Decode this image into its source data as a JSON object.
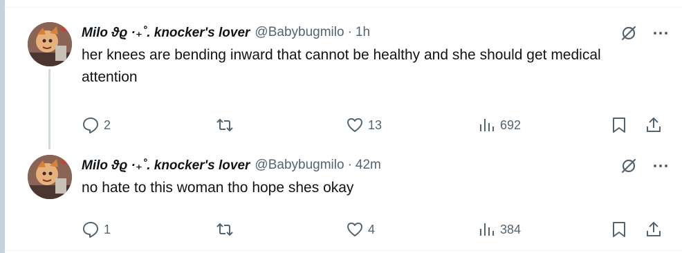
{
  "tweets": [
    {
      "display_name": "Milo ϑϱ ·₊˚. knocker's lover",
      "handle": "@Babybugmilo",
      "separator": "·",
      "time": "1h",
      "text": "her knees are bending inward that cannot be healthy and she should get medical attention",
      "replies": "2",
      "retweets": "",
      "likes": "13",
      "views": "692"
    },
    {
      "display_name": "Milo ϑϱ ·₊˚. knocker's lover",
      "handle": "@Babybugmilo",
      "separator": "·",
      "time": "42m",
      "text": "no hate to this woman tho hope shes okay",
      "replies": "1",
      "retweets": "",
      "likes": "4",
      "views": "384"
    }
  ],
  "colors": {
    "text": "#0f1419",
    "secondary": "#536471",
    "thread_line": "#cfd9de",
    "divider": "#eff3f4"
  },
  "icons": [
    "reply-icon",
    "retweet-icon",
    "like-icon",
    "views-icon",
    "bookmark-icon",
    "share-icon",
    "grok-icon",
    "more-icon"
  ]
}
